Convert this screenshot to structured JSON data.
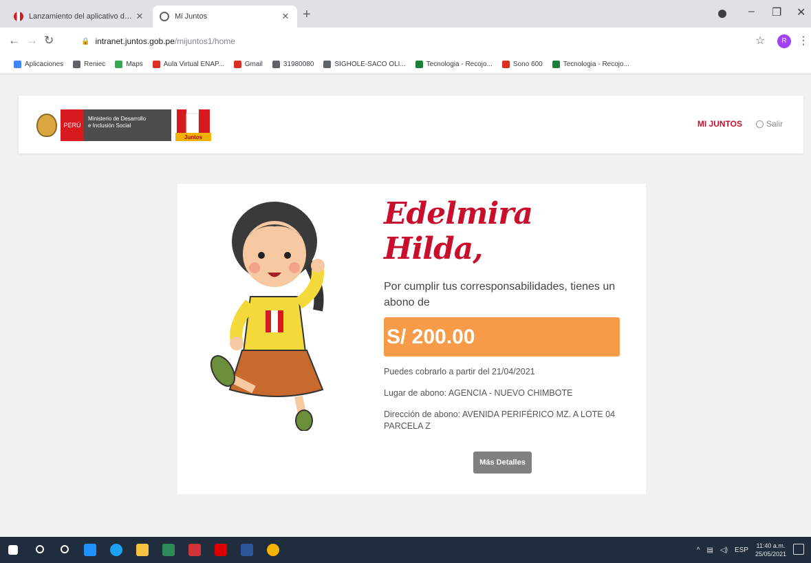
{
  "browser": {
    "tabs": [
      {
        "title": "Lanzamiento del aplicativo de ...",
        "active": false
      },
      {
        "title": "Mi Juntos",
        "active": true
      }
    ],
    "url_host": "intranet.juntos.gob.pe",
    "url_path": "/mijuntos1/home",
    "profile_initial": "R",
    "bookmarks": [
      {
        "label": "Aplicaciones",
        "icon": "apps-grid-icon",
        "color": "#4285f4"
      },
      {
        "label": "Reniec",
        "icon": "globe-icon",
        "color": "#5f6368"
      },
      {
        "label": "Maps",
        "icon": "maps-pin-icon",
        "color": "#34a853"
      },
      {
        "label": "Aula Virtual ENAP...",
        "icon": "red-square-icon",
        "color": "#d93025"
      },
      {
        "label": "Gmail",
        "icon": "gmail-icon",
        "color": "#d93025"
      },
      {
        "label": "31980080",
        "icon": "globe-icon",
        "color": "#5f6368"
      },
      {
        "label": "SIGHOLE-SACO OLI...",
        "icon": "doc-icon",
        "color": "#5f6368"
      },
      {
        "label": "Tecnologia - Recojo...",
        "icon": "drive-icon",
        "color": "#188038"
      },
      {
        "label": "Sono 600",
        "icon": "flag-icon",
        "color": "#d93025"
      },
      {
        "label": "Tecnologia - Recojo...",
        "icon": "drive-icon",
        "color": "#188038"
      }
    ]
  },
  "header": {
    "peru_label": "PERÚ",
    "ministry_line1": "Ministerio de Desarrollo",
    "ministry_line2": "e Inclusión Social",
    "logo_text": "Juntos",
    "nav_mijuntos": "MI JUNTOS",
    "nav_salir": "Salir"
  },
  "card": {
    "greeting": "Edelmira Hilda,",
    "lead": "Por cumplir tus corresponsabilidades, tienes un abono de",
    "amount": "S/ 200.00",
    "cobro": "Puedes cobrarlo a partir del 21/04/2021",
    "lugar": "Lugar de abono: AGENCIA - NUEVO CHIMBOTE",
    "direccion": "Dirección de abono: AVENIDA PERIFÉRICO MZ. A LOTE 04 PARCELA Z",
    "button": "Más Detalles"
  },
  "taskbar": {
    "time": "11:40 a.m.",
    "date": "25/05/2021",
    "lang": "ESP"
  },
  "colors": {
    "accent_red": "#c8102e",
    "amount_orange": "#f79b49",
    "button_gray": "#808080"
  }
}
